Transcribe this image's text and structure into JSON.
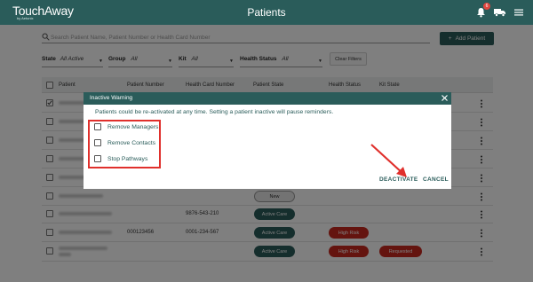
{
  "header": {
    "logo": "TouchAway",
    "logo_sub": "by Aetonix",
    "title": "Patients",
    "notification_count": "6"
  },
  "toolbar": {
    "search_placeholder": "Search Patient Name, Patient Number or Health Card Number",
    "add_patient_label": "Add Patient",
    "add_icon": "+"
  },
  "filters": {
    "state_label": "State",
    "state_value": "All Active",
    "group_label": "Group",
    "group_value": "All",
    "kit_label": "Kit",
    "kit_value": "All",
    "health_label": "Health Status",
    "health_value": "All",
    "clear_label": "Clear Filters"
  },
  "table": {
    "columns": [
      "Patient",
      "Patient Number",
      "Health Card Number",
      "Patient State",
      "Health Status",
      "Kit State"
    ],
    "rows": [
      {
        "patient_number": "",
        "health_card": "",
        "state": "",
        "health": "",
        "kit": ""
      },
      {
        "patient_number": "",
        "health_card": "",
        "state": "",
        "health": "",
        "kit": ""
      },
      {
        "patient_number": "",
        "health_card": "",
        "state": "",
        "health": "",
        "kit": ""
      },
      {
        "patient_number": "",
        "health_card": "",
        "state": "",
        "health": "",
        "kit": ""
      },
      {
        "patient_number": "",
        "health_card": "",
        "state": "",
        "health": "",
        "kit": ""
      },
      {
        "patient_number": "",
        "health_card": "",
        "state": "",
        "health": "",
        "kit": ""
      },
      {
        "patient_number": "",
        "health_card": "",
        "state": "New",
        "health": "",
        "kit": ""
      },
      {
        "patient_number": "",
        "health_card": "9876-543-210",
        "state": "Active Care",
        "health": "",
        "kit": ""
      },
      {
        "patient_number": "000123456",
        "health_card": "0001-234-567",
        "state": "Active Care",
        "health": "High Risk",
        "kit": ""
      },
      {
        "patient_number": "",
        "health_card": "",
        "state": "Active Care",
        "health": "High Risk",
        "kit": "Requested"
      }
    ]
  },
  "modal": {
    "title": "Inactive Warning",
    "message": "Patients could be re-activated at any time. Setting a patient inactive will pause reminders.",
    "options": [
      "Remove Managers",
      "Remove Contacts",
      "Stop Pathways"
    ],
    "deactivate_label": "DEACTIVATE",
    "cancel_label": "CANCEL"
  },
  "colors": {
    "brand": "#2a5c5a",
    "danger": "#c8281e",
    "highlight": "#e0302c"
  }
}
